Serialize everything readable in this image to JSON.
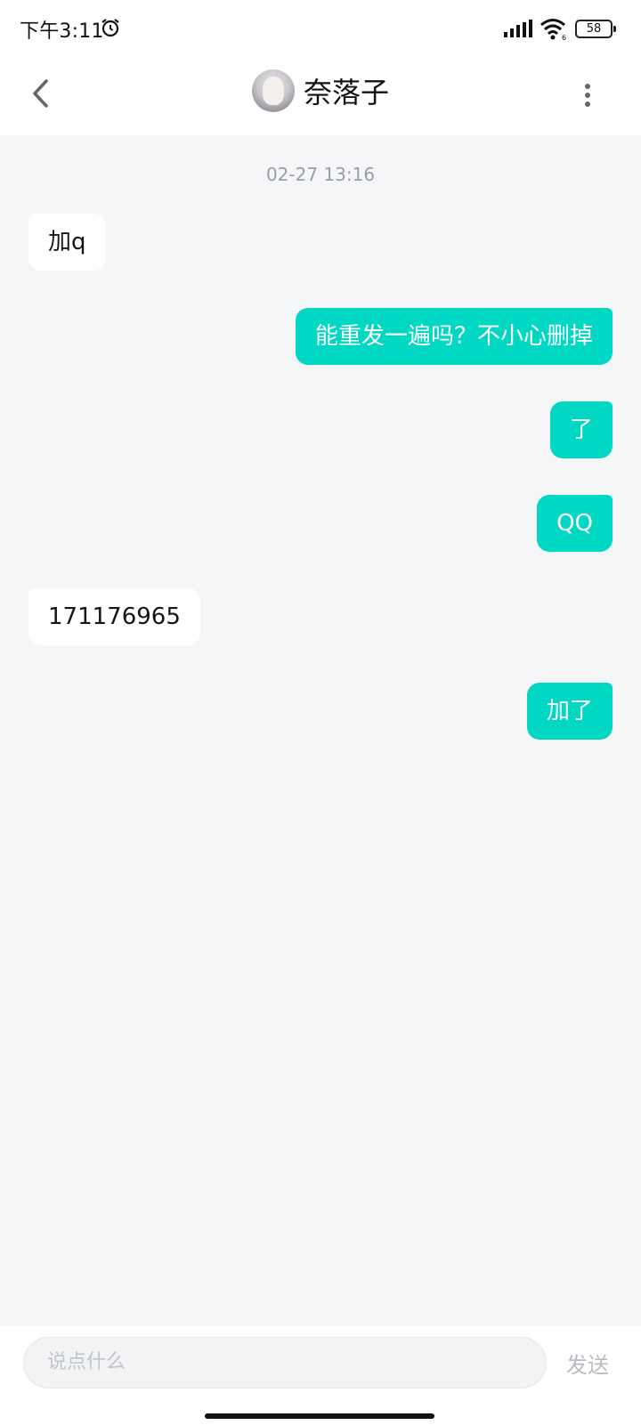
{
  "status_bar": {
    "time": "下午3:11",
    "battery": "58",
    "icons": [
      "alarm-icon",
      "signal-icon",
      "wifi-icon",
      "battery-icon"
    ]
  },
  "header": {
    "title": "奈落子",
    "icons": [
      "back-icon",
      "avatar",
      "more-icon"
    ]
  },
  "chat": {
    "timestamp": "02-27 13:16",
    "messages": [
      {
        "side": "in",
        "text": "加q"
      },
      {
        "side": "out",
        "text": "能重发一遍吗？不小心删掉"
      },
      {
        "side": "out",
        "text": "了"
      },
      {
        "side": "out",
        "text": "QQ"
      },
      {
        "side": "in",
        "text": "171176965"
      },
      {
        "side": "out",
        "text": "加了"
      }
    ]
  },
  "composer": {
    "placeholder": "说点什么",
    "send_label": "发送"
  },
  "colors": {
    "accent": "#00d8c4",
    "background": "#f5f6f8"
  }
}
